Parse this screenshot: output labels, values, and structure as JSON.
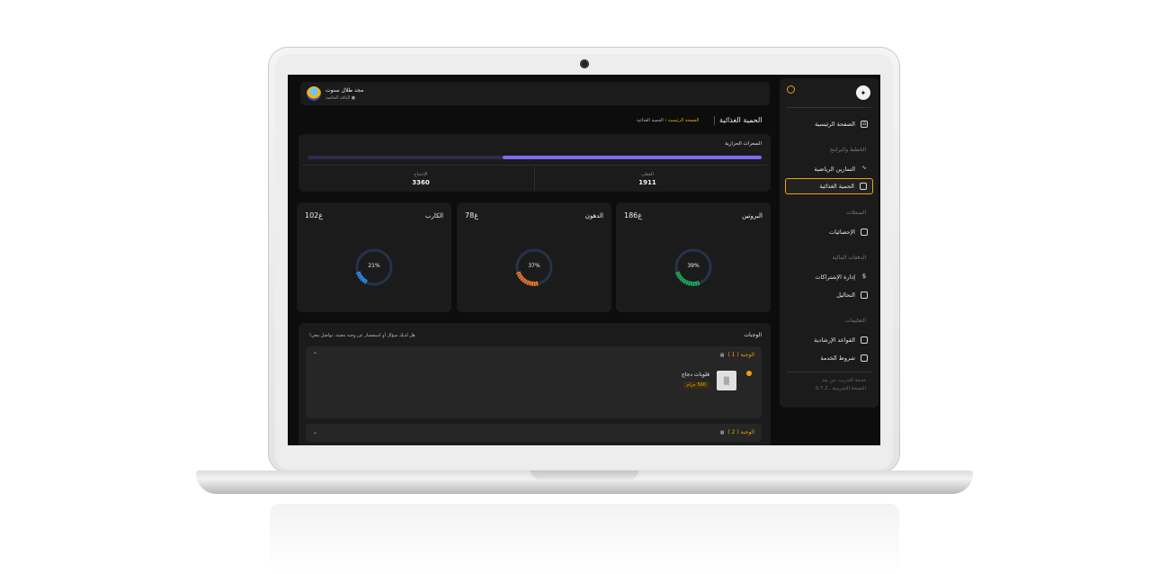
{
  "header": {
    "user_name": "مجد طلال سنوت",
    "user_role": "● الباقة الخاصة"
  },
  "page": {
    "title": "الحمية الغذائية",
    "breadcrumb_home": "الصفحة الرئيسية",
    "breadcrumb_sep": "‹",
    "breadcrumb_current": "الحمية الغذائية"
  },
  "sidebar": {
    "home": "الصفحة الرئيسية",
    "section_plans": "الخطط والبرامج",
    "workouts": "التمارين الرياضية",
    "diet": "الحمية الغذائية",
    "section_records": "السجلات",
    "statistics": "الإحصائيات",
    "section_payments": "الدفعات المالية",
    "subscriptions": "إدارة الإشتراكات",
    "analyses": "التحاليل",
    "section_instructions": "التعليمات",
    "guidelines": "القواعد الإرشادية",
    "terms": "شروط الخدمة",
    "footer_line1": "خدمة التدريب عن بعد",
    "footer_line2": "النسخة التجريبية ـ 0.7.2"
  },
  "calories": {
    "title": "السعرات الحرارية",
    "progress": 0.57,
    "actual_label": "الفعلي",
    "actual_value": "1911",
    "needed_label": "الإحتياج",
    "needed_value": "3360"
  },
  "macros": [
    {
      "name": "البروتين",
      "amount": "186غ",
      "percent": 39,
      "percent_label": "39%",
      "color": "#1faa5a"
    },
    {
      "name": "الدهون",
      "amount": "78غ",
      "percent": 37,
      "percent_label": "37%",
      "color": "#f07a28"
    },
    {
      "name": "الكارب",
      "amount": "102غ",
      "percent": 21,
      "percent_label": "21%",
      "color": "#2f8df5"
    }
  ],
  "meals": {
    "title": "الوجبات",
    "hint": "هل لديك سؤال أو استفسار عن وجبة معينة، تواصل معي!",
    "items": [
      {
        "label": "الوجبة ( 1 )",
        "expanded": true,
        "food_name": "فلوبات دجاج",
        "food_qty": "500 جرام"
      },
      {
        "label": "الوجبة ( 2 )",
        "expanded": false
      }
    ]
  },
  "icons": {
    "home": "home-icon",
    "workouts": "activity-icon",
    "diet": "cup-icon",
    "statistics": "clipboard-icon",
    "subscriptions": "dollar-icon",
    "analyses": "document-icon",
    "guidelines": "file-icon",
    "terms": "file-icon"
  },
  "colors": {
    "accent": "#f0a500",
    "calorie_bar": "#7b6cf0",
    "background": "#0d0d0d",
    "card": "#1b1b1b"
  }
}
